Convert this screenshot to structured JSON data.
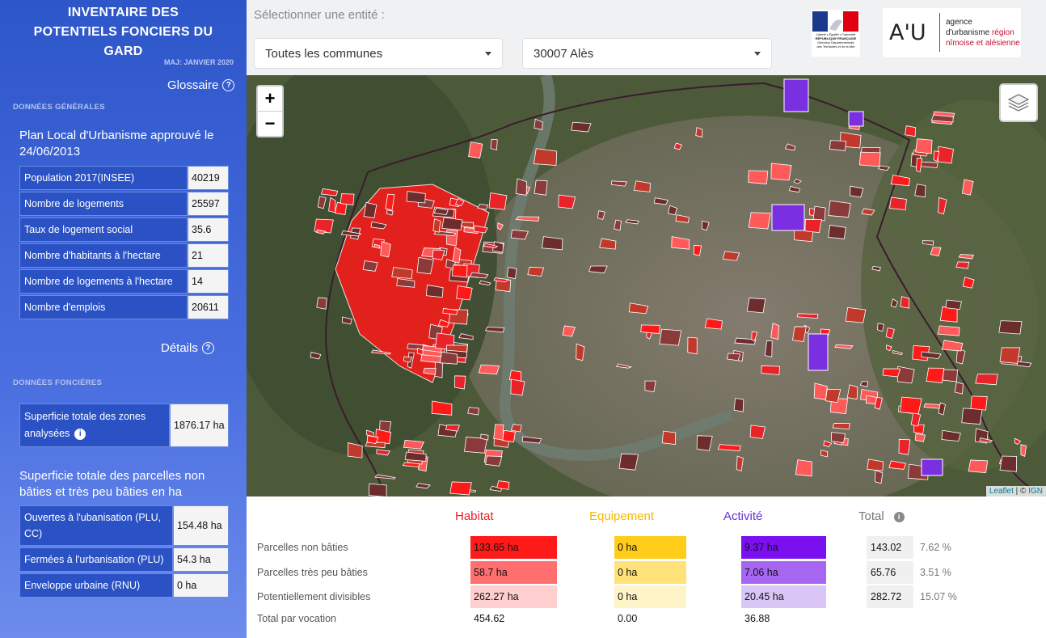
{
  "sidebar": {
    "title_line1": "INVENTAIRE DES",
    "title_line2": "POTENTIELS FONCIERS DU",
    "title_line3": "GARD",
    "maj": "MAJ: JANVIER 2020",
    "glossaire_label": "Glossaire",
    "section_generales": "DONNÉES GÉNÉRALES",
    "plu_title": "Plan Local d'Urbanisme approuvé le 24/06/2013",
    "general_stats": [
      {
        "label": "Population 2017(INSEE)",
        "value": "40219"
      },
      {
        "label": "Nombre de logements",
        "value": "25597"
      },
      {
        "label": "Taux de logement social",
        "value": "35.6"
      },
      {
        "label": "Nombre d'habitants à l'hectare",
        "value": "21"
      },
      {
        "label": "Nombre de logements à l'hectare",
        "value": "14"
      },
      {
        "label": "Nombre d'emplois",
        "value": "20611"
      }
    ],
    "details_label": "Détails",
    "section_foncieres": "DONNÉES FONCIÈRES",
    "superficie_label": "Superficie totale des zones analysées",
    "superficie_value": "1876.17 ha",
    "parcelles_title": "Superficie totale des parcelles non bâties et très peu bâties en ha",
    "parcelles_stats": [
      {
        "label": "Ouvertes à l'ubanisation (PLU, CC)",
        "value": "154.48 ha"
      },
      {
        "label": "Fermées à l'urbanisation (PLU)",
        "value": "54.3 ha"
      },
      {
        "label": "Enveloppe urbaine (RNU)",
        "value": "0 ha"
      }
    ]
  },
  "topbar": {
    "select_label": "Sélectionner une entité :",
    "select_commune": "Toutes les communes",
    "select_entity": "30007 Alès",
    "logo_rf_lines": [
      "Liberté • Égalité • Fraternité",
      "RÉPUBLIQUE FRANÇAISE",
      "Direction Départementale",
      "des Territoires et de la Mer"
    ],
    "logo_au_mark": "A'U",
    "logo_au_lines": [
      "agence",
      "d'urbanisme région",
      "nîmoise et alésienne"
    ]
  },
  "map": {
    "zoom_in": "+",
    "zoom_out": "−",
    "attribution_leaflet": "Leaflet",
    "attribution_sep": " | © ",
    "attribution_ign": "IGN"
  },
  "summary": {
    "columns": {
      "habitat": "Habitat",
      "equipement": "Equipement",
      "activite": "Activité",
      "total": "Total"
    },
    "colors": {
      "habitat": "#e8232a",
      "equipement": "#f5b800",
      "activite": "#6a2fd1",
      "total": "#777777"
    },
    "rows": [
      {
        "label": "Parcelles non bâties",
        "habitat": "133.65 ha",
        "equipement": "0 ha",
        "activite": "9.37 ha",
        "total": "143.02",
        "pct": "7.62 %"
      },
      {
        "label": "Parcelles très peu bâties",
        "habitat": "58.7 ha",
        "equipement": "0 ha",
        "activite": "7.06 ha",
        "total": "65.76",
        "pct": "3.51 %"
      },
      {
        "label": "Potentiellement divisibles",
        "habitat": "262.27 ha",
        "equipement": "0 ha",
        "activite": "20.45 ha",
        "total": "282.72",
        "pct": "15.07 %"
      }
    ],
    "total_row": {
      "label": "Total par vocation",
      "habitat": "454.62",
      "equipement": "0.00",
      "activite": "36.88"
    }
  }
}
